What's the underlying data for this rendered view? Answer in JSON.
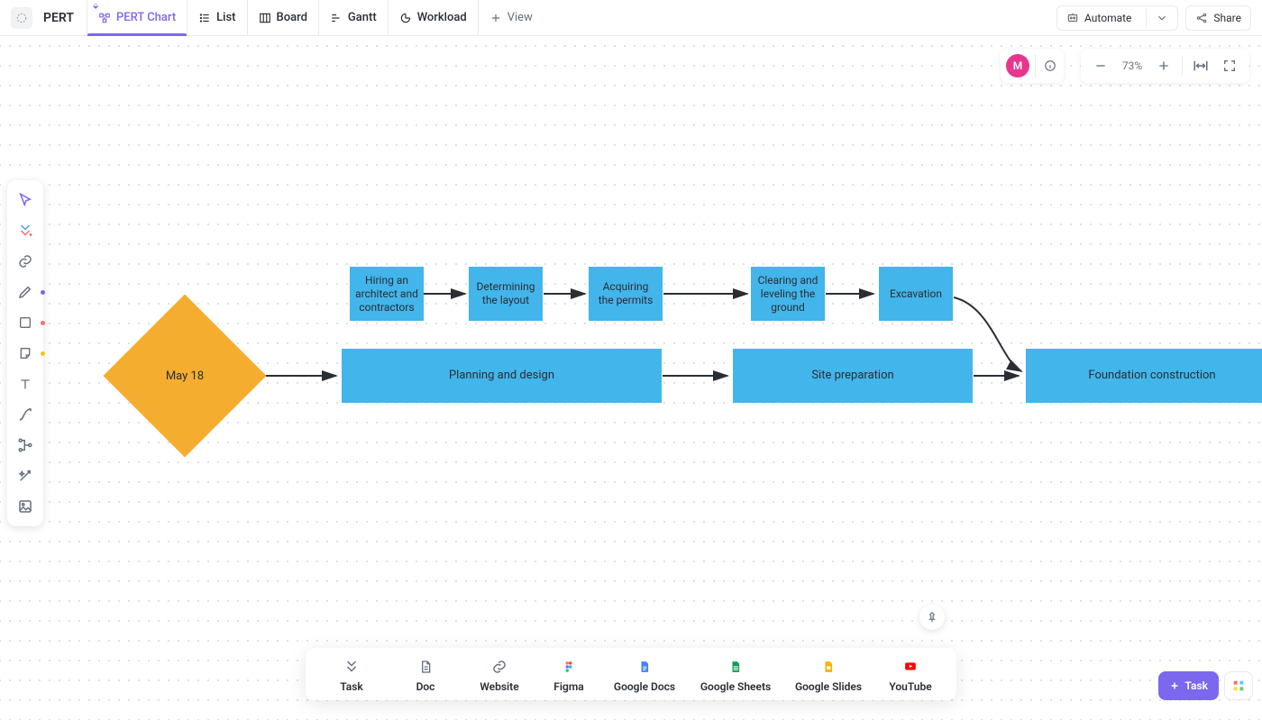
{
  "app": {
    "title": "PERT"
  },
  "tabs": {
    "pert": "PERT Chart",
    "list": "List",
    "board": "Board",
    "gantt": "Gantt",
    "workload": "Workload",
    "addview": "View"
  },
  "topright": {
    "automate": "Automate",
    "share": "Share"
  },
  "avatar": {
    "initial": "M"
  },
  "zoom": {
    "value": "73%"
  },
  "nodes": {
    "start": "May 18",
    "small": {
      "a": "Hiring an architect and contractors",
      "b": "Determining the layout",
      "c": "Acquiring the permits",
      "d": "Clearing and leveling the ground",
      "e": "Excavation"
    },
    "big": {
      "a": "Planning and design",
      "b": "Site preparation",
      "c": "Foundation construction"
    }
  },
  "dock": {
    "task": "Task",
    "doc": "Doc",
    "website": "Website",
    "figma": "Figma",
    "gdocs": "Google Docs",
    "gsheets": "Google Sheets",
    "gslides": "Google Slides",
    "youtube": "YouTube"
  },
  "footer": {
    "task_button": "Task"
  }
}
